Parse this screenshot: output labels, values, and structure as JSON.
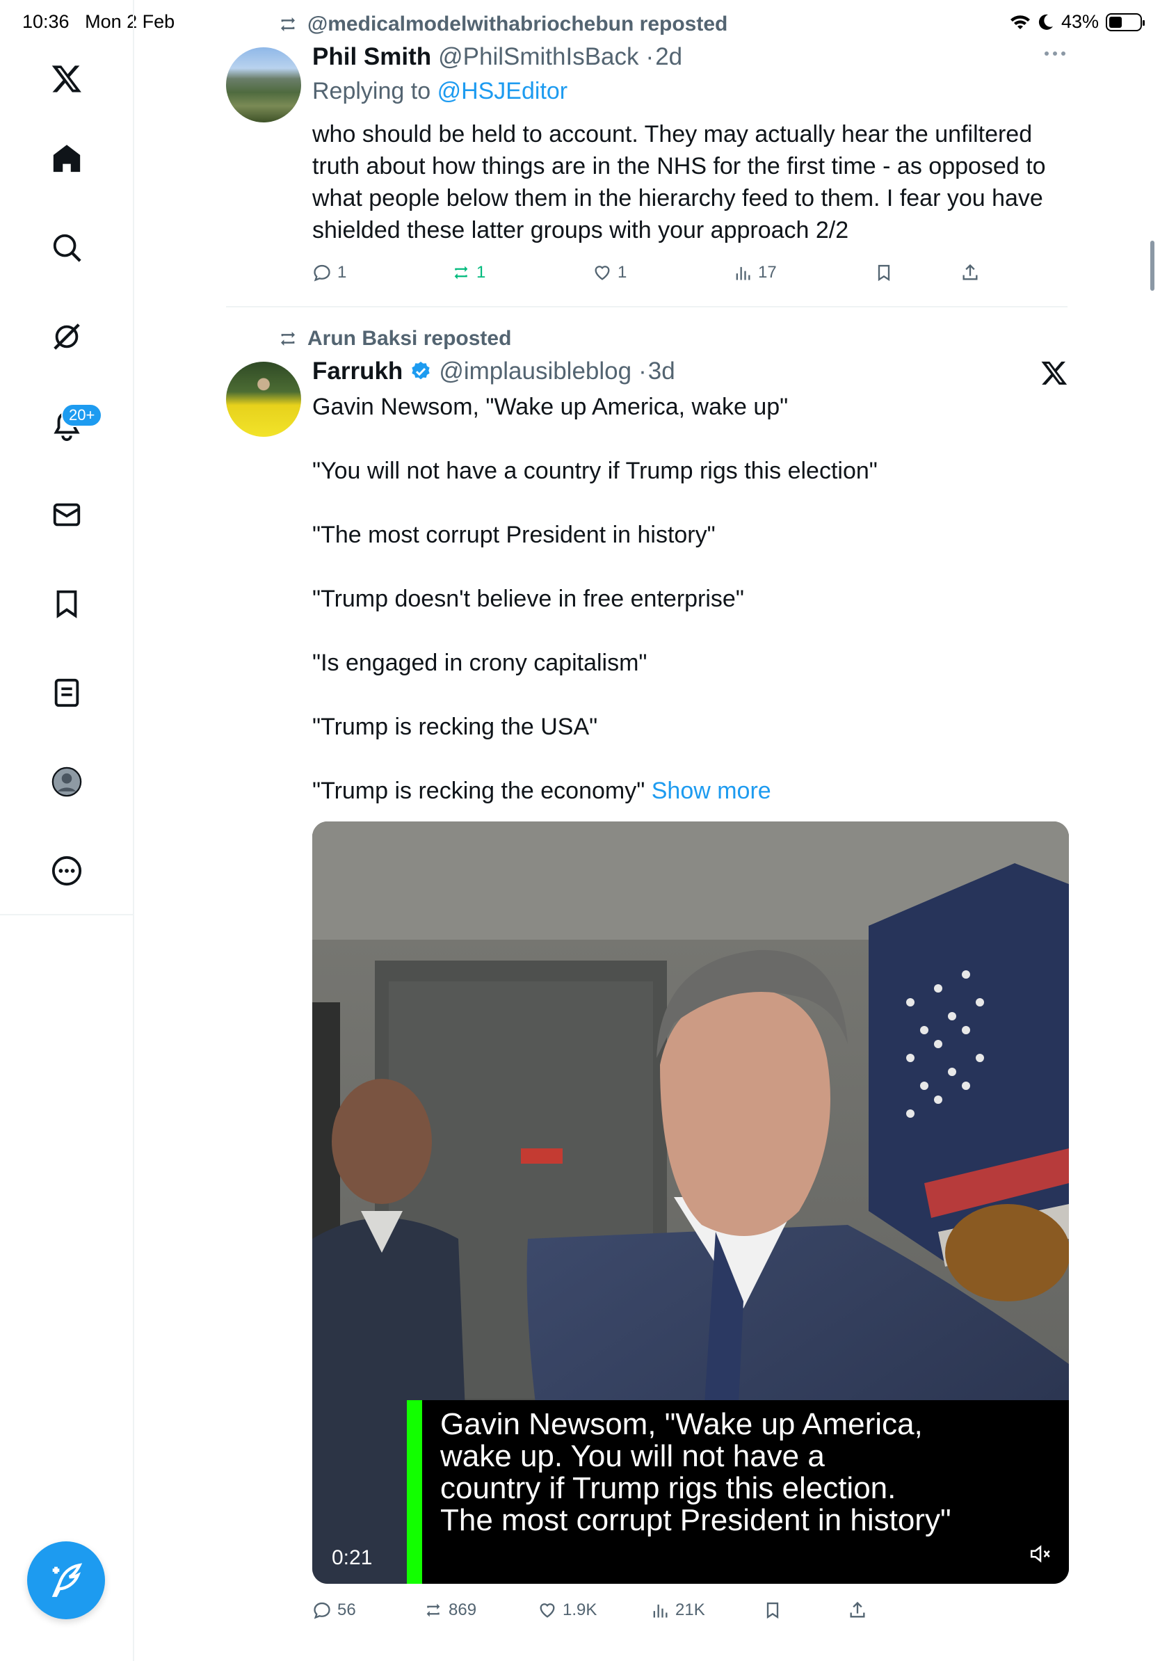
{
  "status_bar": {
    "time": "10:36",
    "date": "Mon 2 Feb",
    "battery": "43%",
    "battery_fraction": 0.43
  },
  "sidebar": {
    "items": [
      {
        "icon": "x-logo-icon"
      },
      {
        "icon": "home-icon"
      },
      {
        "icon": "search-icon"
      },
      {
        "icon": "grok-icon"
      },
      {
        "icon": "notifications-icon",
        "badge": "20+"
      },
      {
        "icon": "messages-icon"
      },
      {
        "icon": "bookmarks-icon"
      },
      {
        "icon": "lists-icon"
      },
      {
        "icon": "profile-icon"
      },
      {
        "icon": "more-icon"
      }
    ],
    "compose_icon": "compose-icon"
  },
  "tweet1": {
    "reposted_by": "@medicalmodelwithabriochebun reposted",
    "name": "Phil Smith",
    "handle": "@PhilSmithIsBack",
    "time": "2d",
    "replying_label": "Replying to",
    "replying_to": "@HSJEditor",
    "text_lines": [
      "who should be held to account.  They may actually hear the unfiltered",
      "truth about how things are in the NHS for the first time - as opposed to",
      "what people below them in the hierarchy feed to them. I fear you have",
      "shielded these latter groups with your approach 2/2"
    ],
    "replies": "1",
    "reposts": "1",
    "likes": "1",
    "views": "17"
  },
  "tweet2": {
    "reposted_by": "Arun Baksi reposted",
    "name": "Farrukh",
    "handle": "@implausibleblog",
    "time": "3d",
    "paragraphs": [
      "Gavin Newsom, \"Wake up America, wake up\"",
      "\"You will not have a country if Trump rigs this election\"",
      "\"The most corrupt President in history\"",
      "\"Trump doesn't believe in free enterprise\"",
      "\"Is engaged in crony capitalism\"",
      "\"Trump is recking the USA\""
    ],
    "last_line": "\"Trump is recking the economy\"",
    "show_more": "Show more",
    "video": {
      "caption_lines": [
        "Gavin Newsom, \"Wake up America,",
        "wake up. You will not have a",
        "country if Trump rigs this election.",
        "The most corrupt President in history\""
      ],
      "duration": "0:21"
    },
    "replies": "56",
    "reposts": "869",
    "likes": "1.9K",
    "views": "21K"
  },
  "colors": {
    "accent": "#1d9bf0",
    "repost_green": "#00ba7c",
    "secondary_text": "#536471",
    "caption_bar": "#12ff00"
  }
}
